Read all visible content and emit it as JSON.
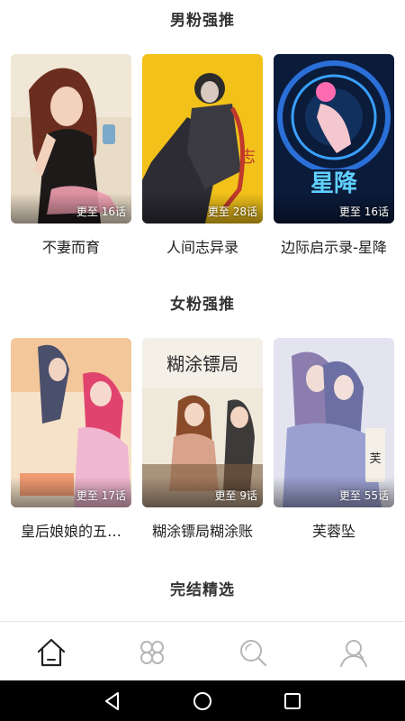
{
  "sections": [
    {
      "title": "男粉强推",
      "items": [
        {
          "title": "不妻而育",
          "badge": "更至 16话"
        },
        {
          "title": "人间志异录",
          "badge": "更至 28话"
        },
        {
          "title": "边际启示录-星降",
          "badge": "更至 16话"
        }
      ]
    },
    {
      "title": "女粉强推",
      "items": [
        {
          "title": "皇后娘娘的五…",
          "badge": "更至 17话"
        },
        {
          "title": "糊涂镖局糊涂账",
          "badge": "更至 9话"
        },
        {
          "title": "芙蓉坠",
          "badge": "更至 55话"
        }
      ]
    },
    {
      "title": "完结精选",
      "items": []
    }
  ],
  "colors": {
    "accent": "#222222",
    "inactive_icon": "#b5b5b5",
    "navbar": "#000000"
  },
  "tabbar": {
    "tabs": [
      {
        "icon": "home-icon",
        "active": true
      },
      {
        "icon": "category-icon",
        "active": false
      },
      {
        "icon": "search-icon",
        "active": false
      },
      {
        "icon": "user-icon",
        "active": false
      }
    ]
  },
  "system_nav": {
    "buttons": [
      "back-icon",
      "home-circle-icon",
      "recents-icon"
    ]
  }
}
